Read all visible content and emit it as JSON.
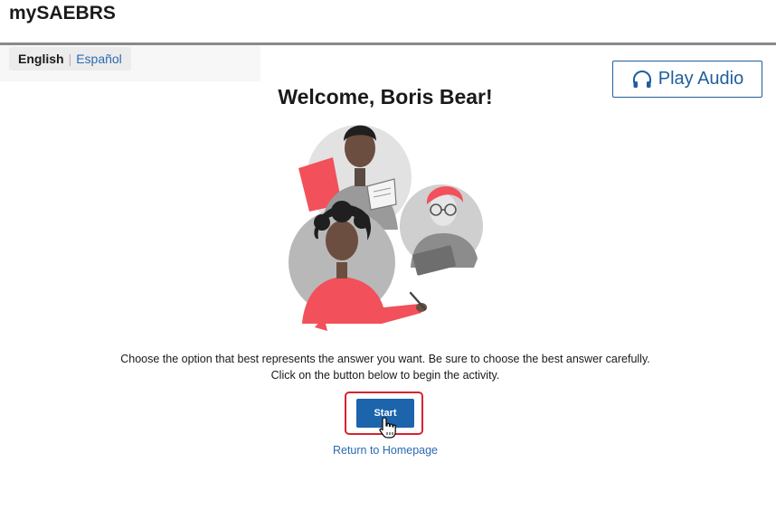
{
  "app": {
    "title": "mySAEBRS"
  },
  "language": {
    "active": "English",
    "separator": "|",
    "alternate": "Español"
  },
  "audio": {
    "label": "Play Audio",
    "icon": "headphones-icon"
  },
  "welcome": {
    "heading": "Welcome, Boris Bear!"
  },
  "illustration": {
    "icon": "students-illustration"
  },
  "instructions": {
    "line1": "Choose the option that best represents the answer you want. Be sure to choose the best answer carefully.",
    "line2": "Click on the button below to begin the activity."
  },
  "actions": {
    "start_label": "Start",
    "return_label": "Return to Homepage"
  },
  "colors": {
    "primary": "#1c64ac",
    "link": "#2a6ab0",
    "highlight": "#d7242f",
    "accent": "#f2505a"
  }
}
